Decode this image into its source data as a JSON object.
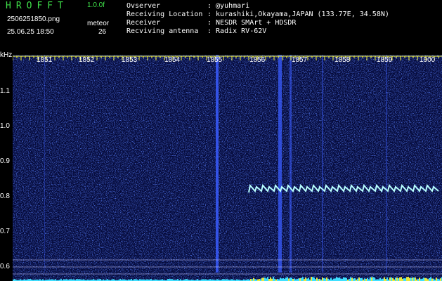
{
  "header": {
    "app_title": "HROFFT",
    "version": "1.0.0f",
    "filename": "2506251850.png",
    "file_type": "meteor",
    "timestamp": "25.06.25 18:50",
    "count": "26"
  },
  "station_info": [
    {
      "label": "Ovserver",
      "value": ": @yuhmari"
    },
    {
      "label": "Receiving Location",
      "value": ": kurashiki,Okayama,JAPAN (133.77E, 34.58N)"
    },
    {
      "label": "Receiver",
      "value": ": NESDR SMArt + HDSDR"
    },
    {
      "label": "Recviving antenna",
      "value": ": Radix RV-62V"
    }
  ],
  "spectrogram": {
    "y_unit": "kHz",
    "x_ticks": [
      "1851",
      "1852",
      "1853",
      "1854",
      "1855",
      "1856",
      "1857",
      "1858",
      "1859",
      "1900"
    ],
    "y_ticks": [
      "1.1",
      "1.0",
      "0.9",
      "0.8",
      "0.7",
      "0.6"
    ],
    "colors": {
      "background": "#050a3a",
      "noise": "#3a5cff",
      "signal": "#b8ffff",
      "axis": "#ffff40",
      "level": "#40e0ff"
    }
  }
}
